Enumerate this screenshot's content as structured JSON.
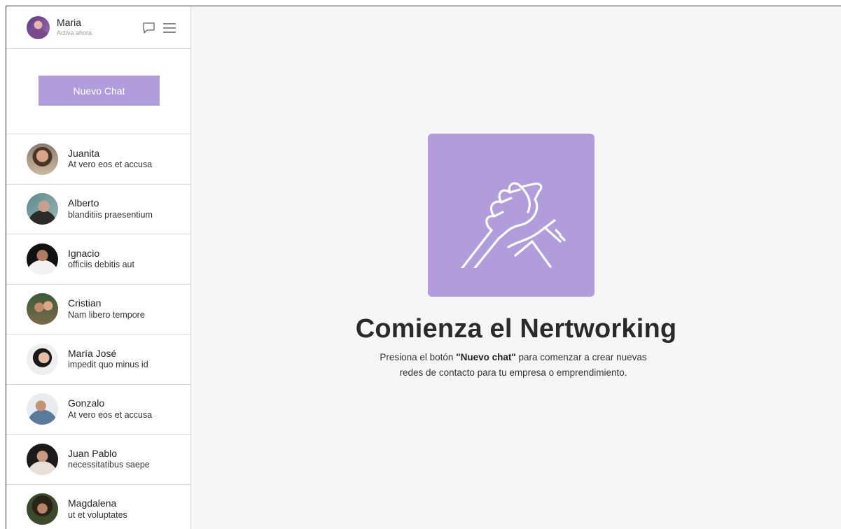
{
  "user": {
    "name": "Maria",
    "status": "Activa ahora"
  },
  "header_icons": [
    "chat-bubble-icon",
    "menu-icon"
  ],
  "new_chat": {
    "label": "Nuevo Chat"
  },
  "contacts": [
    {
      "name": "Juanita",
      "message": "At vero eos et accusa"
    },
    {
      "name": "Alberto",
      "message": "blanditiis praesentium"
    },
    {
      "name": "Ignacio",
      "message": "officiis debitis aut"
    },
    {
      "name": "Cristian",
      "message": "Nam libero tempore"
    },
    {
      "name": "María José",
      "message": " impedit quo minus id"
    },
    {
      "name": "Gonzalo",
      "message": "At vero eos et accusa"
    },
    {
      "name": "Juan Pablo",
      "message": "necessitatibus saepe"
    },
    {
      "name": "Magdalena",
      "message": "ut et voluptates"
    }
  ],
  "hero": {
    "icon": "handshake-icon",
    "title": "Comienza el Nertworking",
    "desc_prefix": "Presiona el botón ",
    "desc_bold": "\"Nuevo chat\"",
    "desc_suffix_line1": " para comenzar a crear nuevas",
    "desc_line2": "redes de contacto para tu empresa o emprendimiento."
  },
  "colors": {
    "accent": "#b19ddb",
    "background": "#f6f6f6"
  }
}
